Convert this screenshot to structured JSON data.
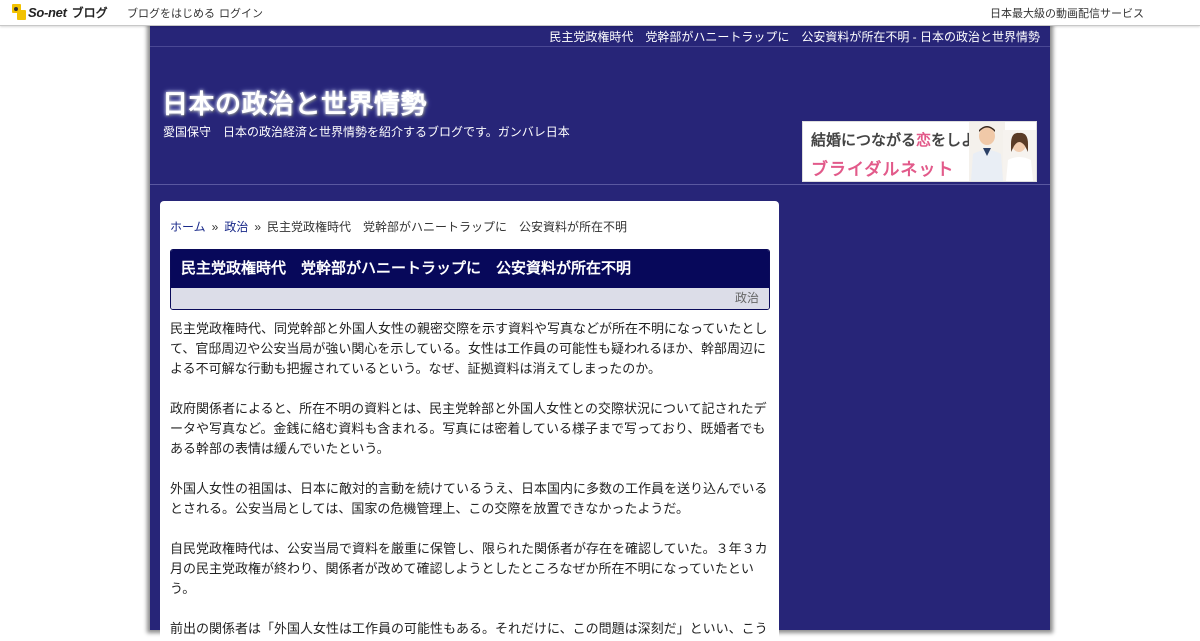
{
  "topbar": {
    "logo_text": "So-net",
    "logo_blog": "ブログ",
    "start_link": "ブログをはじめる",
    "login_link": "ログイン",
    "service_text": "日本最大級の動画配信サービス"
  },
  "header": {
    "page_title_link": "民主党政権時代　党幹部がハニートラップに　公安資料が所在不明 - 日本の政治と世界情勢",
    "blog_title": "日本の政治と世界情勢",
    "blog_description": "愛国保守　日本の政治経済と世界情勢を紹介するブログです。ガンバレ日本"
  },
  "ad": {
    "line1_pre": "結婚につながる",
    "line1_pink": "恋",
    "line1_post": "をしよう。",
    "brand": "ブライダルネット"
  },
  "breadcrumb": {
    "home": "ホーム",
    "sep1": "»",
    "category": "政治",
    "sep2": "»",
    "current": "民主党政権時代　党幹部がハニートラップに　公安資料が所在不明"
  },
  "article": {
    "title": "民主党政権時代　党幹部がハニートラップに　公安資料が所在不明",
    "category": "政治",
    "paragraphs": [
      "民主党政権時代、同党幹部と外国人女性の親密交際を示す資料や写真などが所在不明になっていたとして、官邸周辺や公安当局が強い関心を示している。女性は工作員の可能性も疑われるほか、幹部周辺による不可解な行動も把握されているという。なぜ、証拠資料は消えてしまったのか。",
      "政府関係者によると、所在不明の資料とは、民主党幹部と外国人女性との交際状況について記されたデータや写真など。金銭に絡む資料も含まれる。写真には密着している様子まで写っており、既婚者でもある幹部の表情は緩んでいたという。",
      "外国人女性の祖国は、日本に敵対的言動を続けているうえ、日本国内に多数の工作員を送り込んでいるとされる。公安当局としては、国家の危機管理上、この交際を放置できなかったようだ。",
      "自民党政権時代は、公安当局で資料を厳重に保管し、限られた関係者が存在を確認していた。３年３カ月の民主党政権が終わり、関係者が改めて確認しようとしたところなぜか所在不明になっていたという。",
      "前出の関係者は「外国人女性は工作員の可能性もある。それだけに、この問題は深刻だ」といい、こう"
    ]
  },
  "colors": {
    "frame_bg": "#272578",
    "title_bar": "#07085a",
    "link": "#1a2a8a",
    "ad_pink": "#e25a8a",
    "logo_yellow": "#f2c200"
  }
}
